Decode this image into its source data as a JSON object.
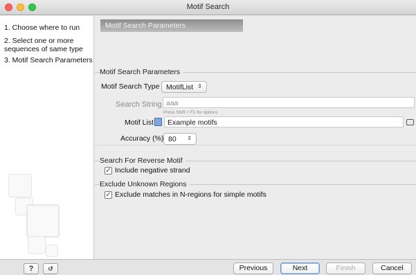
{
  "window": {
    "title": "Motif Search"
  },
  "sidebar": {
    "steps": [
      {
        "label": "1. Choose where to run"
      },
      {
        "label": "2. Select one or more sequences of same type"
      },
      {
        "label": "3. Motif Search Parameters"
      }
    ]
  },
  "main": {
    "section_title": "Motif Search Parameters",
    "params_group": {
      "label": "Motif Search Parameters",
      "type_label": "Motif Search Type",
      "type_value": "MotifList",
      "search_string_label": "Search String",
      "search_string_value": "aaa",
      "search_hint": "Press Shift + F1 for options",
      "motif_list_label": "Motif List",
      "motif_list_value": "Example motifs",
      "accuracy_label": "Accuracy (%)",
      "accuracy_value": "80"
    },
    "reverse_group": {
      "label": "Search For Reverse Motif",
      "checkbox_label": "Include negative strand",
      "checked": true
    },
    "unknown_group": {
      "label": "Exclude Unknown Regions",
      "checkbox_label": "Exclude matches in N-regions for simple motifs",
      "checked": true
    }
  },
  "footer": {
    "help_label": "?",
    "previous_label": "Previous",
    "next_label": "Next",
    "finish_label": "Finish",
    "cancel_label": "Cancel"
  }
}
